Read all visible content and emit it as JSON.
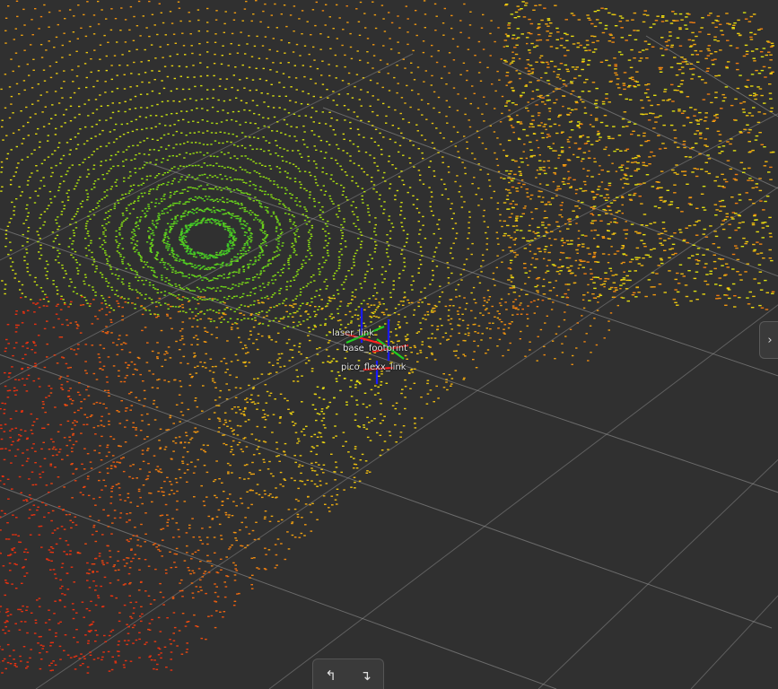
{
  "viewport": {
    "background": "#303030",
    "grid_color": "#9a9a9a",
    "point_cloud_colormap": [
      "#1e90c8",
      "#20c030",
      "#8ee010",
      "#e8e010",
      "#f09010",
      "#e83010"
    ]
  },
  "frames": {
    "labels": [
      "laser_link",
      "base_footprint",
      "pico_flexx_link"
    ]
  },
  "right_panel": {
    "toggle_icon": "chevron-right-icon",
    "glyph": "›"
  },
  "bottom_controls": {
    "rotate_left": {
      "icon": "rotate-left-icon",
      "glyph": "↰"
    },
    "rotate_right": {
      "icon": "rotate-right-icon",
      "glyph": "↴"
    }
  }
}
